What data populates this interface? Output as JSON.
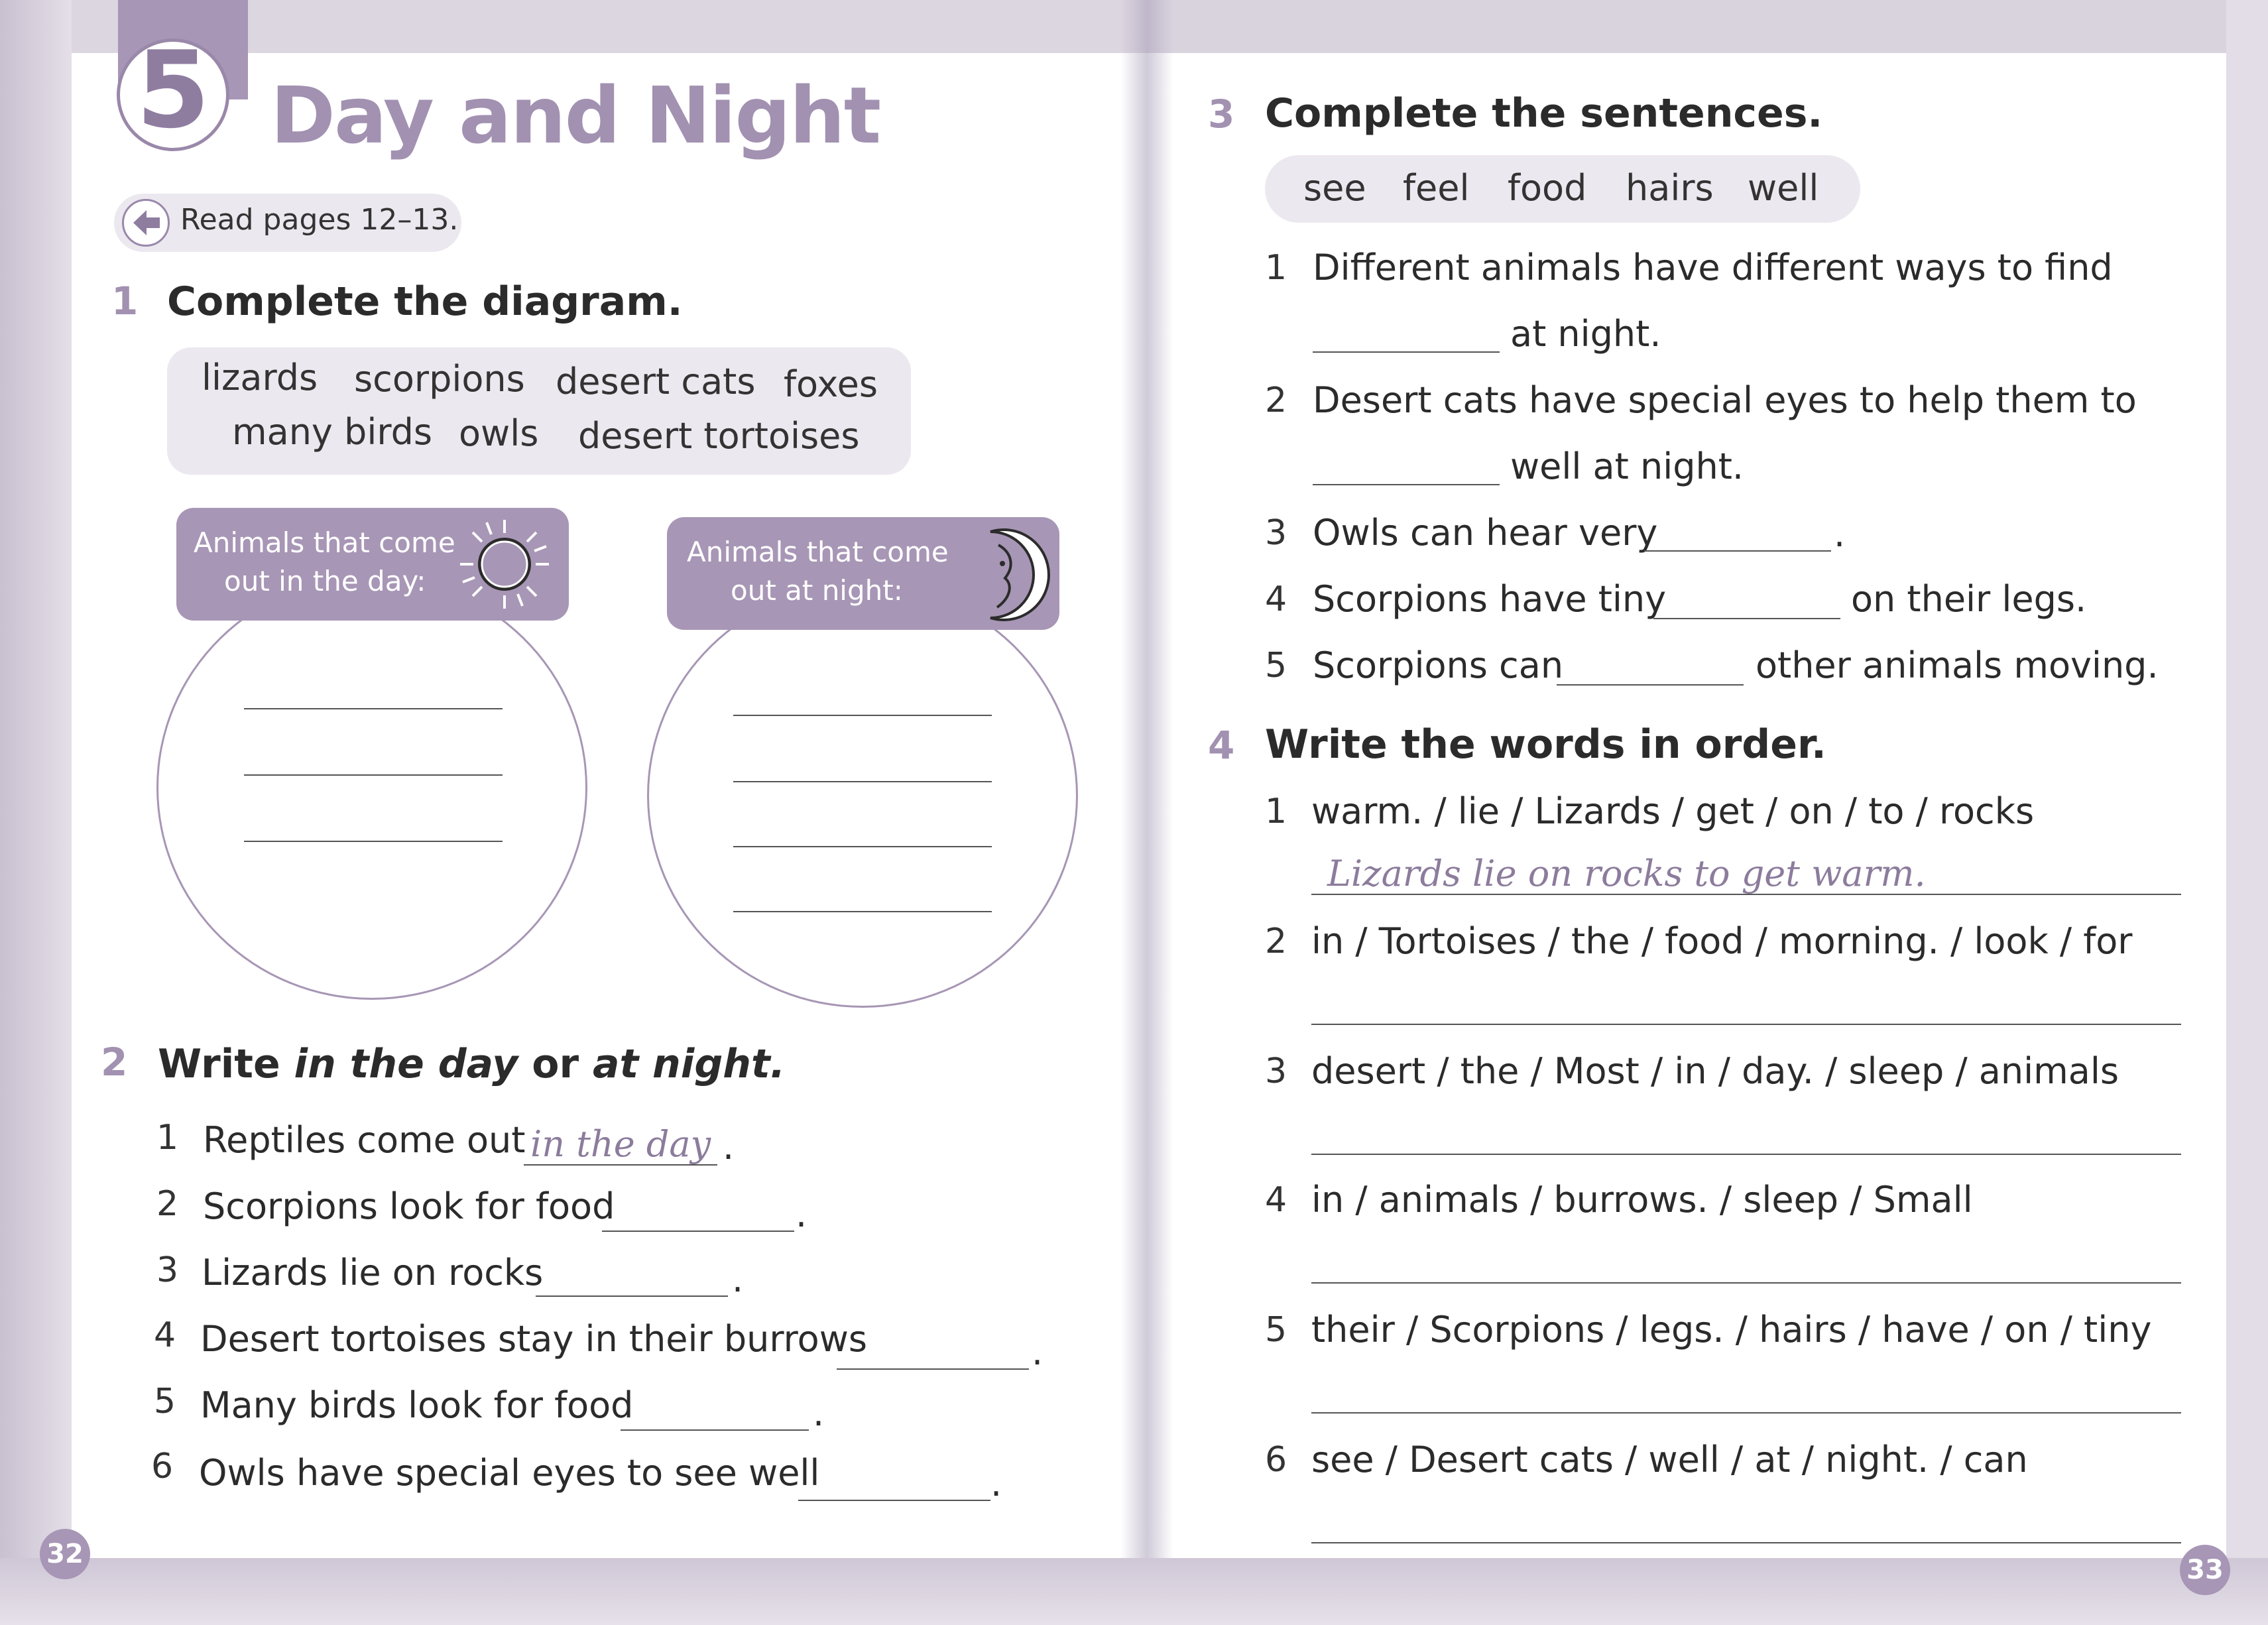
{
  "unit": {
    "number": "5",
    "title": "Day and Night",
    "read_pages": "Read pages 12–13."
  },
  "ex1": {
    "number": "1",
    "title": "Complete the diagram.",
    "words_row1": [
      "lizards",
      "scorpions",
      "desert cats",
      "foxes"
    ],
    "words_row2": [
      "many birds",
      "owls",
      "desert tortoises"
    ],
    "day_heading_line1": "Animals that come",
    "day_heading_line2": "out in the day:",
    "night_heading_line1": "Animals that come",
    "night_heading_line2": "out at night:"
  },
  "ex2": {
    "number": "2",
    "title_part1": "Write ",
    "title_italic1": "in the day",
    "title_part2": " or ",
    "title_italic2": "at night.",
    "items": [
      {
        "n": "1",
        "text": "Reptiles come out",
        "answer": "in the day",
        "end": "."
      },
      {
        "n": "2",
        "text": "Scorpions look for food",
        "answer": "",
        "end": "."
      },
      {
        "n": "3",
        "text": "Lizards lie on rocks",
        "answer": "",
        "end": "."
      },
      {
        "n": "4",
        "text": "Desert tortoises stay in their burrows",
        "answer": "",
        "end": "."
      },
      {
        "n": "5",
        "text": "Many birds look for food",
        "answer": "",
        "end": "."
      },
      {
        "n": "6",
        "text": "Owls have special eyes to see well",
        "answer": "",
        "end": "."
      }
    ]
  },
  "ex3": {
    "number": "3",
    "title": "Complete the sentences.",
    "words": [
      "see",
      "feel",
      "food",
      "hairs",
      "well"
    ],
    "items": [
      {
        "n": "1",
        "line1": "Different animals have different ways to find",
        "after": "at night."
      },
      {
        "n": "2",
        "line1": "Desert cats have special eyes to help them to",
        "after": "well at night."
      },
      {
        "n": "3",
        "before": "Owls can hear very",
        "after": "."
      },
      {
        "n": "4",
        "before": "Scorpions have tiny",
        "after": "on their legs."
      },
      {
        "n": "5",
        "before": "Scorpions can",
        "after": "other animals moving."
      }
    ]
  },
  "ex4": {
    "number": "4",
    "title": "Write the words in order.",
    "items": [
      {
        "n": "1",
        "words": "warm. / lie / Lizards / get / on / to / rocks",
        "answer": "Lizards lie on rocks to get warm."
      },
      {
        "n": "2",
        "words": "in / Tortoises / the / food / morning. / look / for",
        "answer": ""
      },
      {
        "n": "3",
        "words": "desert / the / Most / in / day. / sleep / animals",
        "answer": ""
      },
      {
        "n": "4",
        "words": "in / animals / burrows. / sleep / Small",
        "answer": ""
      },
      {
        "n": "5",
        "words": "their / Scorpions / legs. / hairs / have / on / tiny",
        "answer": ""
      },
      {
        "n": "6",
        "words": "see / Desert cats / well / at / night. / can",
        "answer": ""
      }
    ]
  },
  "pages": {
    "left": "32",
    "right": "33"
  },
  "colors": {
    "accent": "#a796b5",
    "heading": "#a291b1",
    "box": "#ece8ef"
  }
}
